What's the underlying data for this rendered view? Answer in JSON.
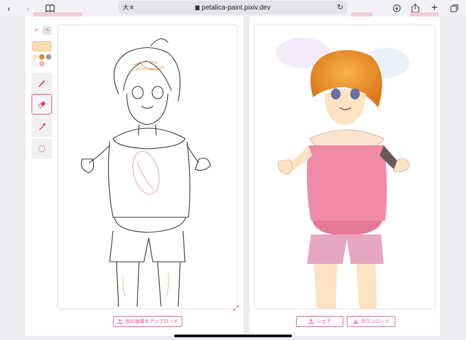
{
  "browser": {
    "reader_label": "大ㅎ",
    "url": "petalica-paint.pixiv.dev",
    "icons": [
      "back-icon",
      "forward-icon",
      "bookmarks-icon",
      "lock-icon",
      "reload-icon",
      "download-icon",
      "share-icon",
      "add-tab-icon",
      "tabs-icon"
    ]
  },
  "left_panel": {
    "palette": {
      "selected": "#fbdcae",
      "swatches": [
        "#fbe6c8",
        "#e8863a",
        "#9a9a9a",
        "#ffffff",
        "#f3b3c7"
      ]
    },
    "tools": [
      "pen-tool",
      "eraser-tool",
      "dropper-tool",
      "hint-tool"
    ],
    "upload_button": "別の画像をアップロード"
  },
  "right_panel": {
    "share_button": "シェア",
    "download_button": "ダウンロード"
  },
  "colors": {
    "accent": "#e04874"
  }
}
